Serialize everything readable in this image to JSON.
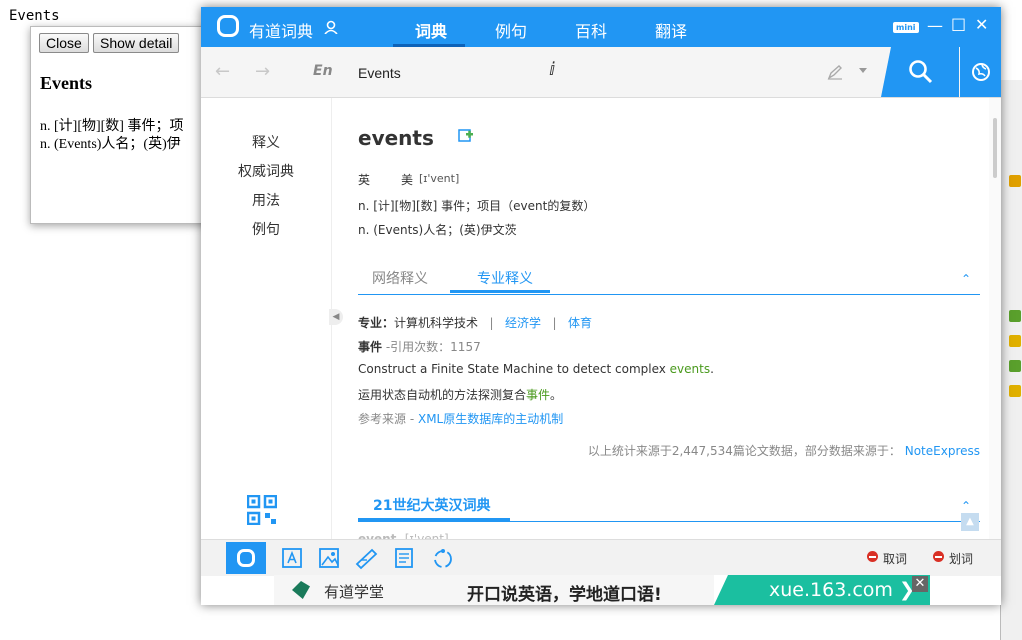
{
  "background": {
    "title": "Events",
    "close_button": "Close",
    "detail_button": "Show detail",
    "heading": "Events",
    "def1": "n. [计][物][数] 事件；项",
    "def2": "n. (Events)人名；(英)伊"
  },
  "app": {
    "name": "有道词典",
    "nav": [
      "词典",
      "例句",
      "百科",
      "翻译"
    ],
    "active_nav": "词典",
    "mini_label": "mini",
    "colors": {
      "primary": "#2196f3",
      "link": "#2196f3",
      "highlight": "#4a9a1d",
      "close_dot": "#d93025"
    }
  },
  "search": {
    "lang": "En",
    "query": "Events"
  },
  "left_nav": [
    "释义",
    "权威词典",
    "用法",
    "例句"
  ],
  "entry": {
    "word": "events",
    "pron_uk": "英",
    "pron_us": "美",
    "phonetic": "[ɪ'vent]",
    "defs": [
      "n. [计][物][数] 事件；项目（event的复数）",
      "n. (Events)人名；(英)伊文茨"
    ],
    "tabs": [
      "网络释义",
      "专业释义"
    ],
    "active_tab": "专业释义",
    "pro": {
      "label": "专业：",
      "fields": [
        "计算机科学技术",
        "经济学",
        "体育"
      ],
      "term": "事件",
      "cite": "-引用次数：1157",
      "example_before": "Construct a Finite State Machine to detect complex ",
      "example_hl": "events",
      "example_after": ".",
      "trans_before": "运用状态自动机的方法探测复合",
      "trans_hl": "事件",
      "trans_after": "。",
      "ref_label": "参考来源 - ",
      "ref_link": "XML原生数据库的主动机制",
      "stat": "以上统计来源于2,447,534篇论文数据，部分数据来源于：",
      "stat_link": "NoteExpress"
    },
    "dict_title": "21世纪大英汉词典",
    "dict_peek_word": "event",
    "dict_peek_phon": "[ɪ'vent]"
  },
  "toolbar": {
    "qu_ci": "取词",
    "hua_ci": "划词"
  },
  "ad": {
    "brand": "有道学堂",
    "slogan": "开口说英语，学地道口语!",
    "url": "xue.163.com"
  },
  "icons": [
    "user-icon",
    "search-icon",
    "globe-icon",
    "pen-icon",
    "add-wordbook-icon",
    "qr-code-icon",
    "minimize-icon",
    "maximize-icon",
    "close-icon"
  ]
}
